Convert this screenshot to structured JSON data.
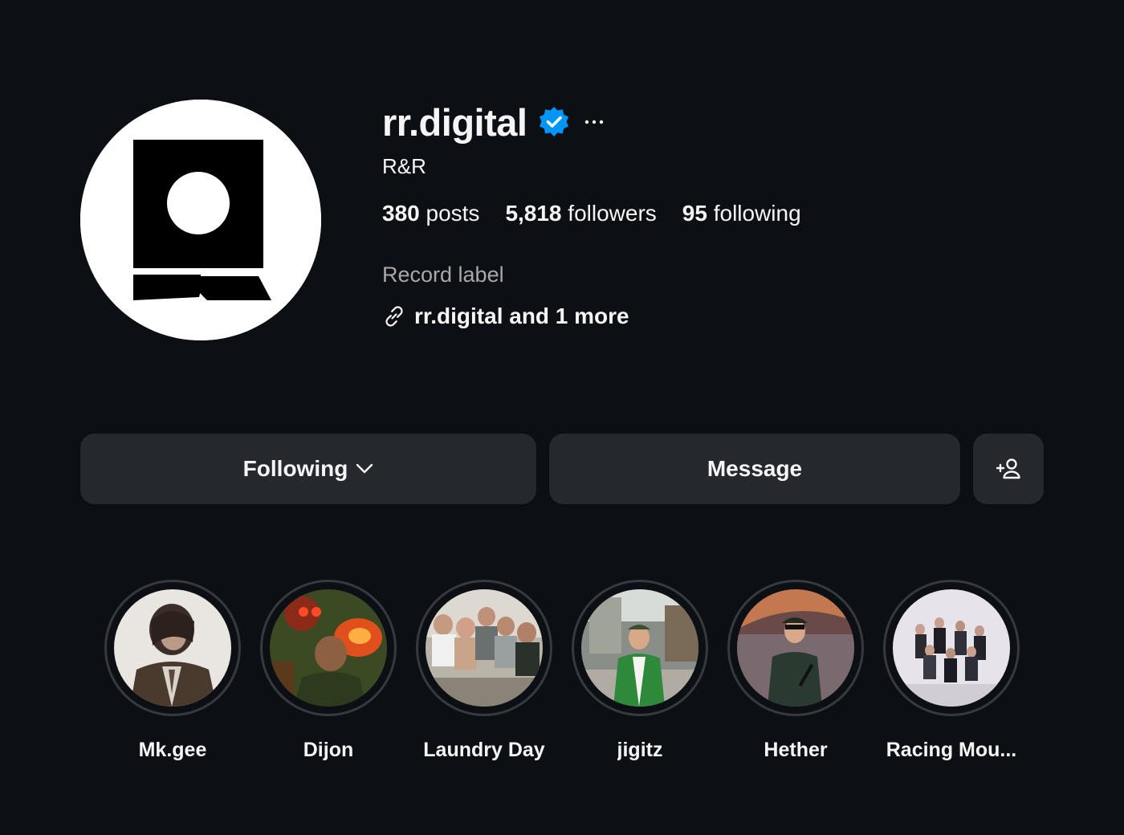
{
  "profile": {
    "username": "rr.digital",
    "verified": true,
    "full_name": "R&R",
    "stats": {
      "posts_count": "380",
      "posts_label": "posts",
      "followers_count": "5,818",
      "followers_label": "followers",
      "following_count": "95",
      "following_label": "following"
    },
    "category": "Record label",
    "link_text": "rr.digital and 1 more"
  },
  "actions": {
    "following_label": "Following",
    "message_label": "Message",
    "add_user_icon": "add-person-icon"
  },
  "highlights": [
    {
      "label": "Mk.gee"
    },
    {
      "label": "Dijon"
    },
    {
      "label": "Laundry Day"
    },
    {
      "label": "jigitz"
    },
    {
      "label": "Hether"
    },
    {
      "label": "Racing Mou..."
    }
  ],
  "colors": {
    "background": "#0c1014",
    "button": "#25292e",
    "verified": "#0095f6",
    "muted_text": "#a8a8a8"
  }
}
